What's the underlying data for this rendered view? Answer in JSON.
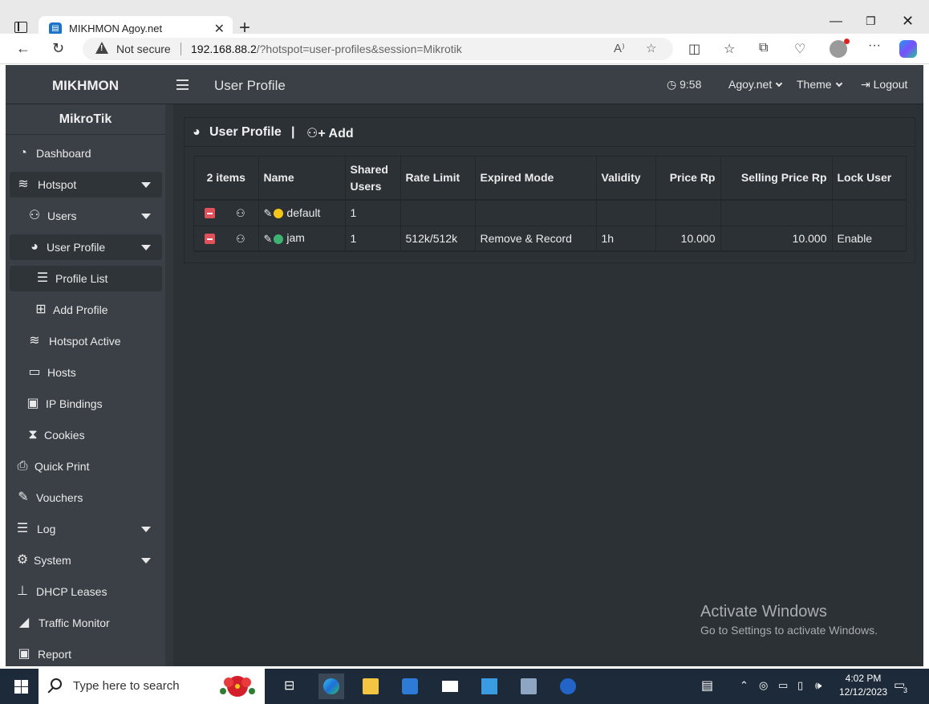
{
  "browser": {
    "tab_title": "MIKHMON Agoy.net",
    "not_secure_label": "Not secure",
    "url_host": "192.168.88.2",
    "url_path": "/?hotspot=user-profiles&session=Mikrotik",
    "new_tab_symbol": "+",
    "tab_close_symbol": "✕"
  },
  "app": {
    "brand": "MIKHMON",
    "page_heading": "User Profile",
    "clock": "9:58",
    "session_menu": "Agoy.net",
    "theme_menu": "Theme",
    "logout": "Logout"
  },
  "sidebar": {
    "title": "MikroTik",
    "items": [
      {
        "label": "Dashboard",
        "icon": "dashboard-icon"
      },
      {
        "label": "Hotspot",
        "icon": "wifi-icon"
      },
      {
        "label": "Users",
        "icon": "users-icon"
      },
      {
        "label": "User Profile",
        "icon": "pie-chart-icon"
      },
      {
        "label": "Profile List",
        "icon": "list-icon"
      },
      {
        "label": "Add Profile",
        "icon": "plus-square-icon"
      },
      {
        "label": "Hotspot Active",
        "icon": "wifi-icon"
      },
      {
        "label": "Hosts",
        "icon": "laptop-icon"
      },
      {
        "label": "IP Bindings",
        "icon": "address-card-icon"
      },
      {
        "label": "Cookies",
        "icon": "hourglass-icon"
      },
      {
        "label": "Quick Print",
        "icon": "printer-icon"
      },
      {
        "label": "Vouchers",
        "icon": "ticket-icon"
      },
      {
        "label": "Log",
        "icon": "log-list-icon"
      },
      {
        "label": "System",
        "icon": "gear-icon"
      },
      {
        "label": "DHCP Leases",
        "icon": "sitemap-icon"
      },
      {
        "label": "Traffic Monitor",
        "icon": "area-chart-icon"
      },
      {
        "label": "Report",
        "icon": "money-icon"
      }
    ]
  },
  "panel": {
    "title": "User Profile",
    "separator": "|",
    "add_label": "Add"
  },
  "table": {
    "headers": {
      "count": "2 items",
      "name": "Name",
      "shared_users": "Shared Users",
      "rate_limit": "Rate Limit",
      "expired_mode": "Expired Mode",
      "validity": "Validity",
      "price": "Price Rp",
      "selling_price": "Selling Price Rp",
      "lock_user": "Lock User"
    },
    "rows": [
      {
        "name": "default",
        "status_color": "#f5c518",
        "shared_users": "1",
        "rate_limit": "",
        "expired_mode": "",
        "validity": "",
        "price": "",
        "selling_price": "",
        "lock_user": ""
      },
      {
        "name": "jam",
        "status_color": "#3cb371",
        "shared_users": "1",
        "rate_limit": "512k/512k",
        "expired_mode": "Remove & Record",
        "validity": "1h",
        "price": "10.000",
        "selling_price": "10.000",
        "lock_user": "Enable"
      }
    ]
  },
  "watermark": {
    "line1": "Activate Windows",
    "line2": "Go to Settings to activate Windows."
  },
  "taskbar": {
    "search_placeholder": "Type here to search",
    "time": "4:02 PM",
    "date": "12/12/2023",
    "notification_count": "3"
  },
  "colors": {
    "app_bg": "#2c3136",
    "sidebar_bg": "#3a4046",
    "delete_red": "#e0525a"
  }
}
